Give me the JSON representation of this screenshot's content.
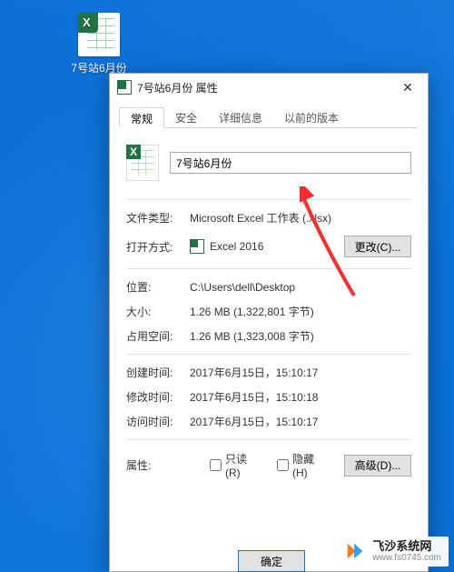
{
  "desktop": {
    "file_label": "7号站6月份"
  },
  "dialog": {
    "title": "7号站6月份 属性",
    "tabs": [
      "常规",
      "安全",
      "详细信息",
      "以前的版本"
    ],
    "filename": "7号站6月份",
    "labels": {
      "file_type": "文件类型:",
      "open_with": "打开方式:",
      "location": "位置:",
      "size": "大小:",
      "size_on_disk": "占用空间:",
      "created": "创建时间:",
      "modified": "修改时间:",
      "accessed": "访问时间:",
      "attributes": "属性:"
    },
    "values": {
      "file_type": "Microsoft Excel 工作表 (.xlsx)",
      "open_with": "Excel 2016",
      "location": "C:\\Users\\dell\\Desktop",
      "size": "1.26 MB (1,322,801 字节)",
      "size_on_disk": "1.26 MB (1,323,008 字节)",
      "created": "2017年6月15日，15:10:17",
      "modified": "2017年6月15日，15:10:18",
      "accessed": "2017年6月15日，15:10:17"
    },
    "checkboxes": {
      "readonly": "只读(R)",
      "hidden": "隐藏(H)"
    },
    "buttons": {
      "change": "更改(C)...",
      "advanced": "高级(D)...",
      "ok": "确定"
    }
  },
  "watermark": {
    "name": "飞沙系统网",
    "url": "www.fs0745.com"
  }
}
